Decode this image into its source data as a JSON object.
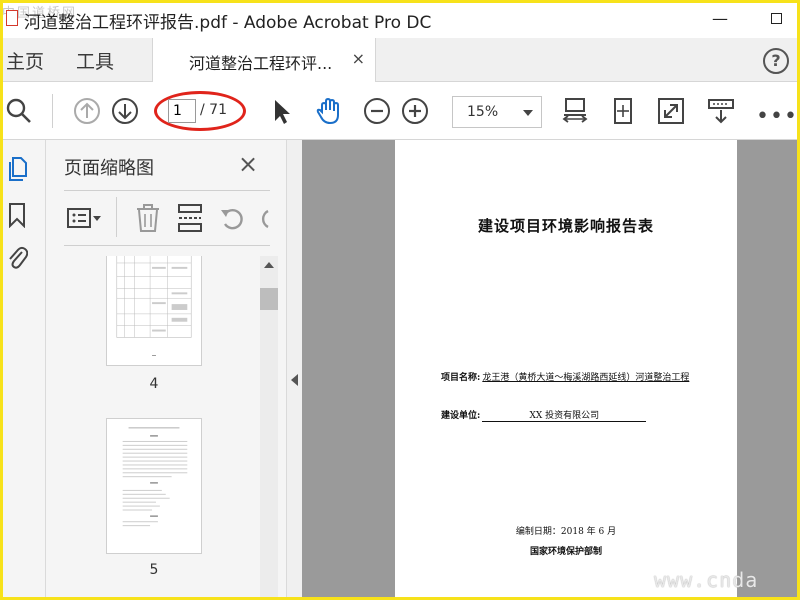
{
  "window": {
    "title": "河道整治工程环评报告.pdf - Adobe Acrobat Pro DC",
    "minimize_label": "—"
  },
  "watermarks": {
    "top": "中国道桥网",
    "bottom": "www.cnda"
  },
  "tabs": {
    "home": "主页",
    "tools": "工具",
    "document": "河道整治工程环评...",
    "close": "×",
    "help": "?"
  },
  "toolbar": {
    "current_page": "1",
    "total_pages": "/ 71",
    "zoom": "15%",
    "more": "•••",
    "icons": [
      "search-icon",
      "page-up-icon",
      "page-down-icon",
      "select-cursor-icon",
      "hand-tool-icon",
      "zoom-out-icon",
      "zoom-in-icon",
      "fit-page-icon",
      "rotate-page-icon",
      "full-screen-icon",
      "read-mode-icon",
      "more-icon"
    ],
    "accent_color": "#1a6fc9",
    "highlight_color": "#e0241b"
  },
  "side_nav": {
    "icons": [
      "page-thumbnails-icon",
      "bookmarks-icon",
      "attachments-icon"
    ]
  },
  "thumbnail_panel": {
    "title": "页面缩略图",
    "close": "×",
    "thumbnails": [
      {
        "page_number": "4"
      },
      {
        "page_number": "5"
      }
    ]
  },
  "document_page": {
    "title": "建设项目环境影响报告表",
    "project_name_label": "项目名称:",
    "project_name_value": "龙王港（黄桥大道～梅溪湖路西延线）河道整治工程",
    "unit_label": "建设单位:",
    "unit_value": "XX 投资有限公司",
    "date": "编制日期：2018 年 6 月",
    "org": "国家环境保护部制"
  }
}
